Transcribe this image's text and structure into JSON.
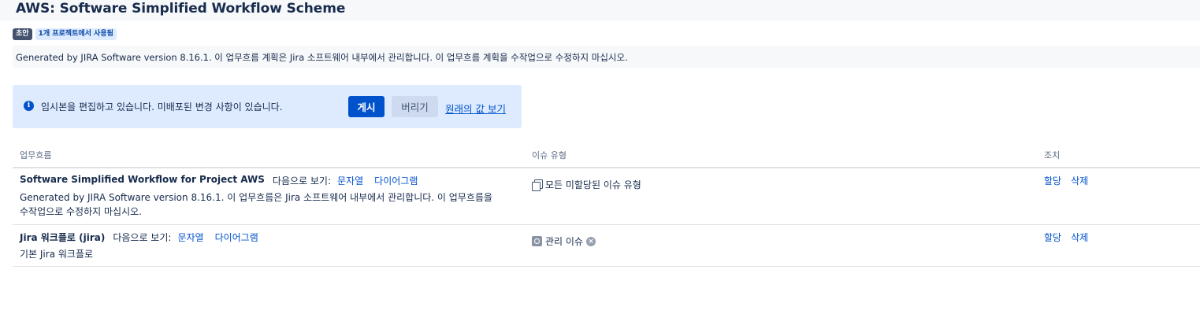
{
  "page": {
    "title": "AWS: Software Simplified Workflow Scheme",
    "badges": {
      "draft": "초안",
      "used_in": "1개 프로젝트에서 사용됨"
    },
    "description": "Generated by JIRA Software version 8.16.1. 이 업무흐름 계획은 Jira 소프트웨어 내부에서 관리합니다. 이 업무흐름 계획을 수작업으로 수정하지 마십시오."
  },
  "banner": {
    "icon": "info-icon",
    "message": "임시본을 편집하고 있습니다. 미배포된 변경 사항이 있습니다.",
    "publish_label": "게시",
    "discard_label": "버리기",
    "view_original_label": "원래의 값 보기"
  },
  "table": {
    "headers": {
      "workflow": "업무흐름",
      "issue_types": "이슈 유형",
      "actions": "조치"
    },
    "rows": [
      {
        "name": "Software Simplified Workflow for Project AWS",
        "view_as": "다음으로 보기:",
        "text_link": "문자열",
        "diagram_link": "다이어그램",
        "description_line1": "Generated by JIRA Software version 8.16.1. 이 업무흐름은 Jira 소프트웨어 내부에서 관리합니다. 이 업무흐름을",
        "description_line2": "수작업으로 수정하지 마십시오.",
        "issue_type": "모든 미할당된 이슈 유형",
        "issue_icon": "pages-icon",
        "assign": "할당",
        "delete": "삭제"
      },
      {
        "name": "Jira 워크플로 (jira)",
        "view_as": "다음으로 보기:",
        "text_link": "문자열",
        "diagram_link": "다이어그램",
        "description_line1": "기본 Jira 워크플로",
        "issue_type": "관리 이슈",
        "issue_icon": "admin-task-icon",
        "remove_icon": "remove-icon",
        "remove_glyph": "×",
        "assign": "할당",
        "delete": "삭제"
      }
    ]
  }
}
